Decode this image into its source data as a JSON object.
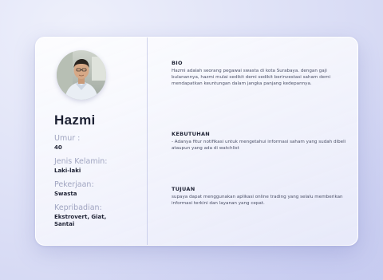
{
  "profile": {
    "name": "Hazmi",
    "fields": [
      {
        "label": "Umur :",
        "value": "40"
      },
      {
        "label": "Jenis Kelamin:",
        "value": "Laki-laki"
      },
      {
        "label": "Pekerjaan:",
        "value": "Swasta"
      },
      {
        "label": "Kepribadian:",
        "value": "Ekstrovert, Giat, Santai"
      }
    ]
  },
  "sections": {
    "bio": {
      "title": "BIO",
      "text": "Hazmi adalah seorang pegawai swasta di kota Surabaya. dengan gaji bulanannya, hazmi mulai sedikit demi sedikit berinvestasi saham demi mendapatkan keuntungan dalam jangka panjang kedepannya."
    },
    "kebutuhan": {
      "title": "KEBUTUHAN",
      "text": "- Adanya fitur notifikasi untuk mengetahui informasi saham yang sudah dibeli ataupun yang ada di watchlist"
    },
    "tujuan": {
      "title": "TUJUAN",
      "text": "supaya dapat menggunakan aplikasi online trading yang selalu memberikan informasi terkini dan layanan yang cepat."
    }
  },
  "colors": {
    "text_dark": "#1e2234",
    "label_muted": "#9fa4c0",
    "card_divider": "#bec2e4"
  }
}
